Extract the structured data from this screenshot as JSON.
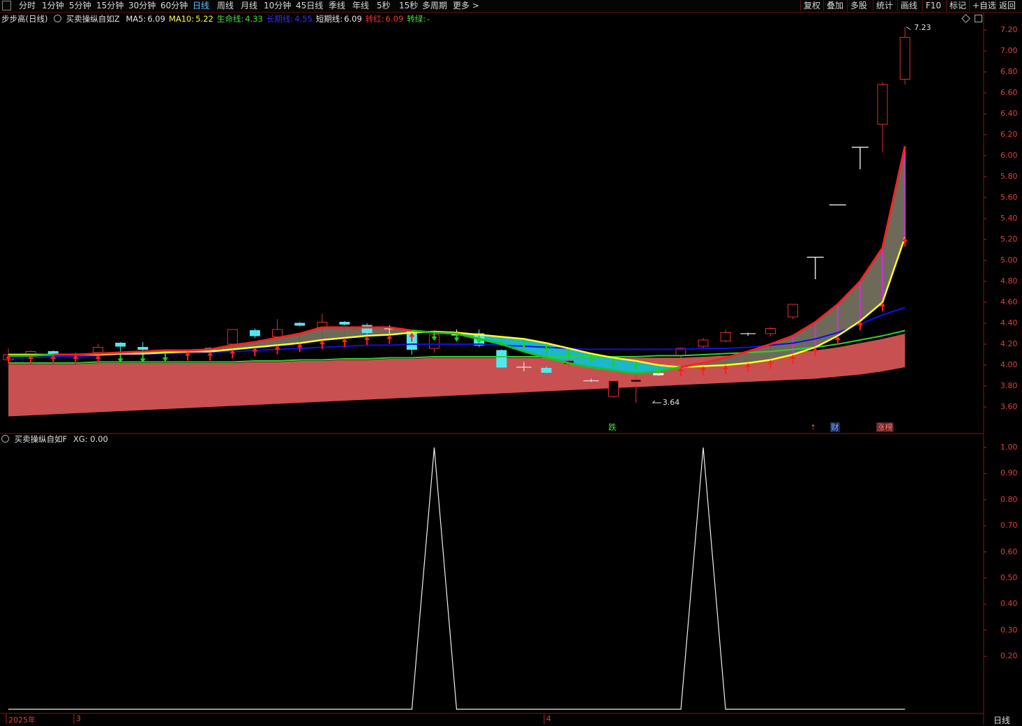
{
  "toolbar": {
    "periods": [
      "分时",
      "1分钟",
      "5分钟",
      "15分钟",
      "30分钟",
      "60分钟",
      "日线",
      "周线",
      "月线",
      "10分钟",
      "45日线",
      "季线",
      "年线",
      "5秒",
      "15秒",
      "多周期",
      "更多 >"
    ],
    "active_period": "日线",
    "buttons": [
      "复权",
      "叠加",
      "多股",
      "统计",
      "画线",
      "F10",
      "标记",
      "+自选",
      "返回"
    ]
  },
  "main_panel": {
    "title": "步步高(日线)",
    "indicator": "买卖操纵自如Z",
    "readouts": [
      {
        "label": "MA5:",
        "value": "6.09",
        "color": "#e8e8e8"
      },
      {
        "label": "MA10:",
        "value": "5.22",
        "color": "#ffff40"
      },
      {
        "label": "生命线:",
        "value": "4.33",
        "color": "#40e040"
      },
      {
        "label": "长期线:",
        "value": "4.55",
        "color": "#3030ff"
      },
      {
        "label": "短期线:",
        "value": "6.09",
        "color": "#e8e8e8"
      },
      {
        "label": "转红:",
        "value": "6.09",
        "color": "#ff3030"
      },
      {
        "label": "转绿:",
        "value": "-",
        "color": "#40e040"
      }
    ],
    "y_ticks": [
      "7.20",
      "7.00",
      "6.80",
      "6.60",
      "6.40",
      "6.20",
      "6.00",
      "5.80",
      "5.60",
      "5.40",
      "5.20",
      "5.00",
      "4.80",
      "4.60",
      "4.40",
      "4.20",
      "4.00",
      "3.80",
      "3.60"
    ],
    "high_label": "7.23",
    "low_label": "3.64",
    "badges": [
      {
        "text": "跌",
        "color": "#40e040",
        "bg": "transparent"
      },
      {
        "text": "财",
        "color": "#7ab0ff",
        "bg": "#1a2a55"
      },
      {
        "text": "涨榜",
        "color": "#ff8080",
        "bg": "#5a1a1a"
      }
    ],
    "arrow_marker": "⇡"
  },
  "sub_panel": {
    "indicator": "买卖操纵自如F",
    "readout_label": "XG:",
    "readout_value": "0.00",
    "y_ticks": [
      "1.00",
      "0.90",
      "0.80",
      "0.70",
      "0.60",
      "0.50",
      "0.40",
      "0.30",
      "0.20"
    ]
  },
  "x_axis": {
    "labels": [
      "2025年",
      "3",
      "4"
    ],
    "period_label": "日线"
  },
  "chart_data": {
    "type": "candlestick",
    "y_range": [
      3.5,
      7.3
    ],
    "candles": [
      {
        "o": 4.1,
        "h": 4.16,
        "l": 4.02,
        "c": 4.05,
        "fill": "hollow"
      },
      {
        "o": 4.1,
        "h": 4.14,
        "l": 4.03,
        "c": 4.13,
        "fill": "hollow"
      },
      {
        "o": 4.13,
        "h": 4.14,
        "l": 4.09,
        "c": 4.11,
        "fill": "cyan"
      },
      {
        "o": 4.08,
        "h": 4.12,
        "l": 4.04,
        "c": 4.1,
        "fill": "hollow"
      },
      {
        "o": 4.12,
        "h": 4.2,
        "l": 4.08,
        "c": 4.17,
        "fill": "hollow"
      },
      {
        "o": 4.21,
        "h": 4.22,
        "l": 4.13,
        "c": 4.18,
        "fill": "cyan"
      },
      {
        "o": 4.17,
        "h": 4.22,
        "l": 4.1,
        "c": 4.15,
        "fill": "cyan"
      },
      {
        "o": 4.13,
        "h": 4.15,
        "l": 4.08,
        "c": 4.12,
        "fill": "cyan"
      },
      {
        "o": 4.12,
        "h": 4.14,
        "l": 4.09,
        "c": 4.13,
        "fill": "hollow"
      },
      {
        "o": 4.16,
        "h": 4.17,
        "l": 4.12,
        "c": 4.14,
        "fill": "cyan"
      },
      {
        "o": 4.2,
        "h": 4.34,
        "l": 4.18,
        "c": 4.34,
        "fill": "hollow"
      },
      {
        "o": 4.33,
        "h": 4.35,
        "l": 4.26,
        "c": 4.28,
        "fill": "cyan"
      },
      {
        "o": 4.27,
        "h": 4.44,
        "l": 4.2,
        "c": 4.34,
        "fill": "hollow"
      },
      {
        "o": 4.4,
        "h": 4.41,
        "l": 4.37,
        "c": 4.38,
        "fill": "cyan"
      },
      {
        "o": 4.36,
        "h": 4.49,
        "l": 4.31,
        "c": 4.41,
        "fill": "hollow"
      },
      {
        "o": 4.41,
        "h": 4.42,
        "l": 4.38,
        "c": 4.39,
        "fill": "cyan"
      },
      {
        "o": 4.38,
        "h": 4.4,
        "l": 4.29,
        "c": 4.31,
        "fill": "cyan"
      },
      {
        "o": 4.36,
        "h": 4.38,
        "l": 4.3,
        "c": 4.36,
        "fill": "white"
      },
      {
        "o": 4.32,
        "h": 4.33,
        "l": 4.1,
        "c": 4.15,
        "fill": "cyan"
      },
      {
        "o": 4.16,
        "h": 4.3,
        "l": 4.12,
        "c": 4.29,
        "fill": "hollow"
      },
      {
        "o": 4.3,
        "h": 4.34,
        "l": 4.26,
        "c": 4.3,
        "fill": "white"
      },
      {
        "o": 4.3,
        "h": 4.34,
        "l": 4.17,
        "c": 4.19,
        "fill": "cyan"
      },
      {
        "o": 4.14,
        "h": 4.15,
        "l": 3.98,
        "c": 3.98,
        "fill": "cyan"
      },
      {
        "o": 3.98,
        "h": 4.03,
        "l": 3.94,
        "c": 3.98,
        "fill": "cross"
      },
      {
        "o": 3.97,
        "h": 3.99,
        "l": 3.92,
        "c": 3.93,
        "fill": "cyan"
      },
      {
        "o": 4.01,
        "h": 4.05,
        "l": 3.98,
        "c": 4.04,
        "fill": "hollow"
      },
      {
        "o": 3.85,
        "h": 3.87,
        "l": 3.84,
        "c": 3.85,
        "fill": "cross"
      },
      {
        "o": 3.7,
        "h": 3.85,
        "l": 3.69,
        "c": 3.85,
        "fill": "hollow"
      },
      {
        "o": 3.84,
        "h": 3.93,
        "l": 3.64,
        "c": 3.86,
        "fill": "hollow"
      },
      {
        "o": 3.92,
        "h": 3.95,
        "l": 3.9,
        "c": 3.91,
        "fill": "white"
      },
      {
        "o": 4.09,
        "h": 4.17,
        "l": 4.07,
        "c": 4.16,
        "fill": "hollow"
      },
      {
        "o": 4.18,
        "h": 4.26,
        "l": 4.16,
        "c": 4.24,
        "fill": "hollow"
      },
      {
        "o": 4.23,
        "h": 4.34,
        "l": 4.22,
        "c": 4.31,
        "fill": "hollow"
      },
      {
        "o": 4.3,
        "h": 4.31,
        "l": 4.28,
        "c": 4.3,
        "fill": "cross"
      },
      {
        "o": 4.3,
        "h": 4.36,
        "l": 4.28,
        "c": 4.35,
        "fill": "hollow"
      },
      {
        "o": 4.46,
        "h": 4.58,
        "l": 4.44,
        "c": 4.58,
        "fill": "hollow"
      },
      {
        "o": 5.03,
        "h": 5.03,
        "l": 4.82,
        "c": 5.03,
        "fill": "tline"
      },
      {
        "o": 5.53,
        "h": 5.53,
        "l": 5.53,
        "c": 5.53,
        "fill": "flat"
      },
      {
        "o": 6.08,
        "h": 6.08,
        "l": 5.87,
        "c": 6.08,
        "fill": "tline"
      },
      {
        "o": 6.3,
        "h": 6.7,
        "l": 6.03,
        "c": 6.68,
        "fill": "hollow"
      },
      {
        "o": 6.73,
        "h": 7.23,
        "l": 6.68,
        "c": 7.13,
        "fill": "hollow"
      }
    ],
    "series": [
      {
        "name": "MA5",
        "values": [
          4.09,
          4.09,
          4.1,
          4.1,
          4.11,
          4.12,
          4.13,
          4.14,
          4.14,
          4.15,
          4.19,
          4.22,
          4.26,
          4.3,
          4.36,
          4.36,
          4.36,
          4.36,
          4.33,
          4.31,
          4.3,
          4.25,
          4.2,
          4.13,
          4.07,
          4.02,
          3.98,
          3.95,
          3.92,
          3.94,
          3.98,
          4.02,
          4.07,
          4.13,
          4.2,
          4.28,
          4.41,
          4.58,
          4.8,
          5.12,
          6.09
        ]
      },
      {
        "name": "MA10",
        "values": [
          4.1,
          4.1,
          4.1,
          4.1,
          4.1,
          4.11,
          4.11,
          4.12,
          4.13,
          4.13,
          4.15,
          4.17,
          4.19,
          4.21,
          4.24,
          4.26,
          4.28,
          4.29,
          4.31,
          4.32,
          4.31,
          4.29,
          4.27,
          4.25,
          4.21,
          4.16,
          4.11,
          4.07,
          4.04,
          4.0,
          3.98,
          3.99,
          4.0,
          4.02,
          4.05,
          4.1,
          4.17,
          4.28,
          4.42,
          4.6,
          5.22
        ]
      },
      {
        "name": "生命线",
        "values": [
          4.02,
          4.02,
          4.02,
          4.02,
          4.03,
          4.03,
          4.03,
          4.03,
          4.03,
          4.03,
          4.03,
          4.04,
          4.04,
          4.05,
          4.05,
          4.06,
          4.06,
          4.07,
          4.07,
          4.08,
          4.08,
          4.08,
          4.08,
          4.08,
          4.08,
          4.08,
          4.08,
          4.08,
          4.08,
          4.09,
          4.09,
          4.1,
          4.11,
          4.12,
          4.13,
          4.15,
          4.17,
          4.2,
          4.24,
          4.28,
          4.33
        ]
      },
      {
        "name": "长期线",
        "values": [
          4.07,
          4.07,
          4.08,
          4.08,
          4.09,
          4.1,
          4.1,
          4.11,
          4.11,
          4.12,
          4.13,
          4.14,
          4.15,
          4.16,
          4.17,
          4.18,
          4.19,
          4.19,
          4.2,
          4.2,
          4.2,
          4.2,
          4.19,
          4.18,
          4.17,
          4.16,
          4.15,
          4.15,
          4.15,
          4.15,
          4.15,
          4.16,
          4.16,
          4.17,
          4.19,
          4.21,
          4.25,
          4.31,
          4.39,
          4.48,
          4.55
        ]
      },
      {
        "name": "转红",
        "values": [
          4.09,
          4.09,
          4.1,
          4.1,
          4.11,
          4.12,
          4.13,
          4.14,
          4.14,
          4.15,
          4.19,
          4.22,
          4.26,
          4.3,
          4.36,
          4.36,
          4.36,
          4.36,
          4.33,
          4.31,
          4.3,
          4.25,
          4.2,
          4.13,
          4.07,
          4.02,
          3.98,
          3.95,
          3.92,
          3.94,
          3.98,
          4.02,
          4.07,
          4.13,
          4.2,
          4.28,
          4.41,
          4.58,
          4.8,
          5.12,
          6.09
        ]
      },
      {
        "name": "转绿",
        "values": [
          4.1,
          4.1,
          4.1,
          4.1,
          4.1,
          4.11,
          4.11,
          4.12,
          4.13,
          4.13,
          4.15,
          4.17,
          4.19,
          4.21,
          4.24,
          4.26,
          4.28,
          4.29,
          4.31,
          4.32,
          4.31,
          4.29,
          4.27,
          4.25,
          4.21,
          4.16,
          4.11,
          4.07,
          4.04,
          4.0,
          3.98,
          3.99,
          4.0,
          4.02,
          4.05,
          4.1,
          4.17,
          4.28,
          4.42,
          4.6,
          5.22
        ]
      }
    ],
    "band_upper": [
      4.01,
      4.01,
      4.01,
      4.01,
      4.02,
      4.02,
      4.02,
      4.02,
      4.02,
      4.02,
      4.02,
      4.03,
      4.03,
      4.04,
      4.04,
      4.05,
      4.05,
      4.06,
      4.06,
      4.07,
      4.07,
      4.07,
      4.07,
      4.07,
      4.07,
      4.07,
      4.07,
      4.07,
      4.07,
      4.07,
      4.07,
      4.08,
      4.09,
      4.1,
      4.11,
      4.12,
      4.14,
      4.17,
      4.21,
      4.25,
      4.3
    ],
    "band_lower": [
      3.51,
      3.52,
      3.53,
      3.54,
      3.55,
      3.56,
      3.57,
      3.58,
      3.59,
      3.6,
      3.61,
      3.62,
      3.63,
      3.64,
      3.65,
      3.66,
      3.67,
      3.68,
      3.69,
      3.7,
      3.71,
      3.72,
      3.73,
      3.74,
      3.75,
      3.76,
      3.77,
      3.78,
      3.79,
      3.8,
      3.81,
      3.82,
      3.83,
      3.84,
      3.85,
      3.86,
      3.87,
      3.89,
      3.91,
      3.94,
      3.98
    ],
    "signals": [
      "up",
      "up",
      "up",
      "up",
      "up",
      "down",
      "down",
      "down",
      "up",
      "up",
      "up",
      "up",
      "up",
      "up",
      "up",
      "up",
      "up",
      "up",
      "up",
      "down",
      "down",
      "down",
      "down",
      "down",
      "down",
      "down",
      "down",
      "down",
      "down",
      "down",
      "up",
      "up",
      "up",
      "up",
      "up",
      "up",
      "up",
      "up",
      "up",
      "up",
      "up"
    ],
    "xg_series": [
      0,
      0,
      0,
      0,
      0,
      0,
      0,
      0,
      0,
      0,
      0,
      0,
      0,
      0,
      0,
      0,
      0,
      0,
      0,
      1,
      0,
      0,
      0,
      0,
      0,
      0,
      0,
      0,
      0,
      0,
      0,
      1,
      0,
      0,
      0,
      0,
      0,
      0,
      0,
      0,
      0
    ],
    "xg_range": [
      0,
      1.05
    ]
  }
}
